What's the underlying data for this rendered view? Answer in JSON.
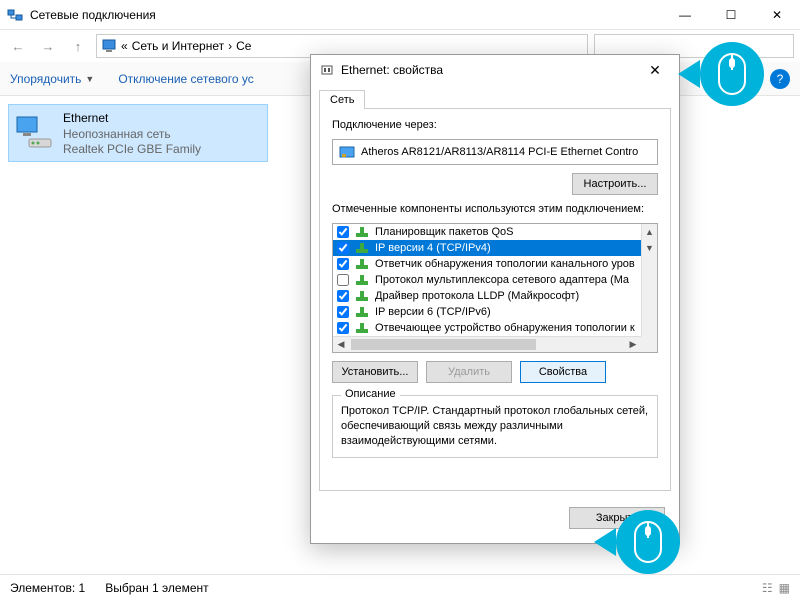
{
  "window": {
    "title": "Сетевые подключения"
  },
  "breadcrumb": {
    "prefix": "«",
    "part1": "Сеть и Интернет",
    "sep": "›",
    "part2": "Се"
  },
  "toolbar": {
    "organize": "Упорядочить",
    "disable": "Отключение сетевого ус"
  },
  "connection": {
    "name": "Ethernet",
    "status": "Неопознанная сеть",
    "device": "Realtek PCIe GBE Family"
  },
  "statusbar": {
    "count": "Элементов: 1",
    "selected": "Выбран 1 элемент"
  },
  "dialog": {
    "title": "Ethernet: свойства",
    "tab": "Сеть",
    "connect_via": "Подключение через:",
    "adapter": "Atheros AR8121/AR8113/AR8114 PCI-E Ethernet Contro",
    "configure": "Настроить...",
    "components_label": "Отмеченные компоненты используются этим подключением:",
    "components": [
      {
        "checked": true,
        "label": "Планировщик пакетов QoS",
        "selected": false
      },
      {
        "checked": true,
        "label": "IP версии 4 (TCP/IPv4)",
        "selected": true
      },
      {
        "checked": true,
        "label": "Ответчик обнаружения топологии канального уров",
        "selected": false
      },
      {
        "checked": false,
        "label": "Протокол мультиплексора сетевого адаптера (Ma",
        "selected": false
      },
      {
        "checked": true,
        "label": "Драйвер протокола LLDP (Майкрософт)",
        "selected": false
      },
      {
        "checked": true,
        "label": "IP версии 6 (TCP/IPv6)",
        "selected": false
      },
      {
        "checked": true,
        "label": "Отвечающее устройство обнаружения топологии к",
        "selected": false
      }
    ],
    "install": "Установить...",
    "uninstall": "Удалить",
    "properties": "Свойства",
    "desc_legend": "Описание",
    "desc_text": "Протокол TCP/IP. Стандартный протокол глобальных сетей, обеспечивающий связь между различными взаимодействующими сетями.",
    "close": "Закрыть"
  }
}
